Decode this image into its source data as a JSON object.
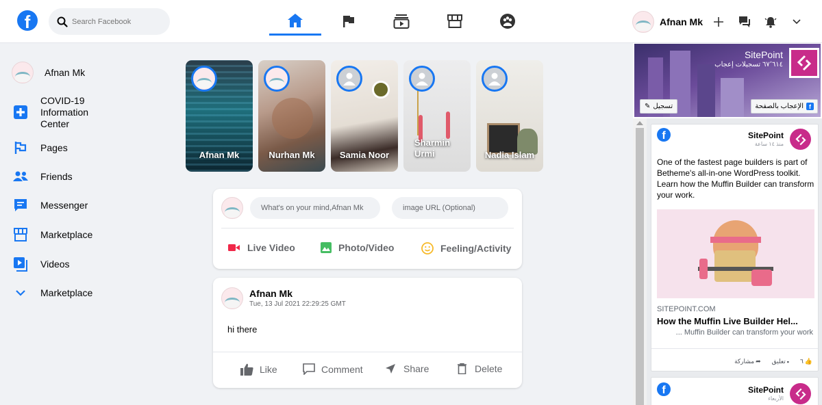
{
  "header": {
    "search_placeholder": "Search Facebook",
    "user_name": "Afnan Mk"
  },
  "sidebar": {
    "user_name": "Afnan Mk",
    "items": [
      {
        "label": "COVID-19 Information Center",
        "icon": "plus-square-icon"
      },
      {
        "label": "Pages",
        "icon": "flag-icon"
      },
      {
        "label": "Friends",
        "icon": "friends-icon"
      },
      {
        "label": "Messenger",
        "icon": "message-icon"
      },
      {
        "label": "Marketplace",
        "icon": "store-icon"
      },
      {
        "label": "Videos",
        "icon": "video-icon"
      },
      {
        "label": "Marketplace",
        "icon": "chevron-down-icon"
      }
    ]
  },
  "stories": [
    {
      "name": "Afnan Mk"
    },
    {
      "name": "Nurhan Mk"
    },
    {
      "name": "Samia Noor"
    },
    {
      "name": "Sharmin Urmi"
    },
    {
      "name": "Nadia Islam"
    }
  ],
  "composer": {
    "text_placeholder": "What's on your  mind,Afnan Mk",
    "image_placeholder": "image URL (Optional)",
    "live_video": "Live Video",
    "photo_video": "Photo/Video",
    "feeling": "Feeling/Activity"
  },
  "post": {
    "author": "Afnan Mk",
    "timestamp": "Tue, 13 Jul 2021 22:29:25 GMT",
    "body": "hi there",
    "like": "Like",
    "comment": "Comment",
    "share": "Share",
    "delete": "Delete"
  },
  "widget": {
    "page_name": "SitePoint",
    "likes_count": "٦٧٬٦١٤ تسجيلات إعجاب",
    "like_page": "الإعجاب بالصفحة",
    "sign_up": "تسجيل",
    "posts": [
      {
        "author": "SitePoint",
        "time": "منذ ١٤ ساعة",
        "text": "One of the fastest page builders is part of Betheme's all-in-one WordPress toolkit. Learn how the Muffin Builder can transform your work.",
        "link_domain": "SITEPOINT.COM",
        "link_title": "How the Muffin Live Builder Hel...",
        "link_desc": "... Muffin Builder can transform your work",
        "likes": "٦",
        "comment": "تعليق",
        "share": "مشاركة"
      },
      {
        "author": "SitePoint",
        "time": "الأربعاء"
      }
    ]
  },
  "colors": {
    "brand": "#1877f2",
    "background": "#f0f2f5",
    "live_red": "#f02849",
    "photo_green": "#45bd62",
    "feeling_yellow": "#f7b928",
    "sitepoint_magenta": "#c82b8a"
  }
}
